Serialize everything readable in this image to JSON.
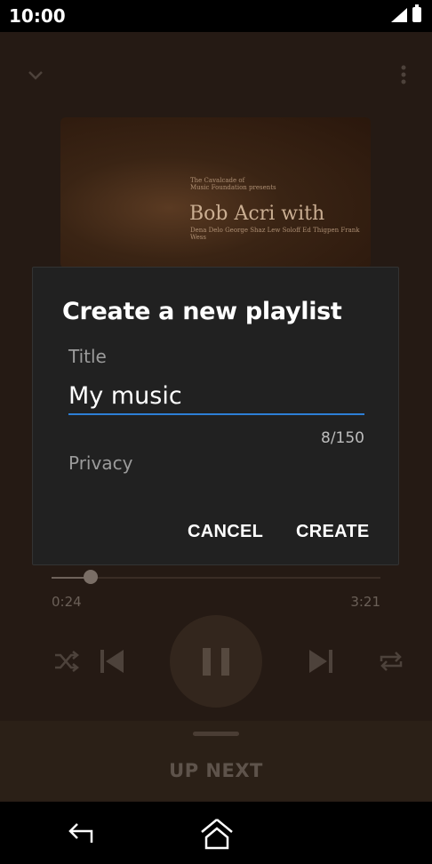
{
  "status_bar": {
    "time": "10:00"
  },
  "album": {
    "line1": "The Cavalcade of",
    "line2": "Music Foundation presents",
    "artist_display": "Bob Acri with",
    "credits": "Dena Delo George Shaz Lew Soloff  Ed Thigpen Frank Wess"
  },
  "player": {
    "elapsed": "0:24",
    "total": "3:21",
    "progress_fraction": 0.12,
    "up_next_label": "UP NEXT"
  },
  "dialog": {
    "title": "Create a new playlist",
    "title_field_label": "Title",
    "title_value": "My music",
    "char_count": "8/150",
    "privacy_label": "Privacy",
    "cancel_label": "CANCEL",
    "create_label": "CREATE"
  },
  "colors": {
    "accent": "#2d7fd6",
    "dialog_bg": "#212121"
  }
}
